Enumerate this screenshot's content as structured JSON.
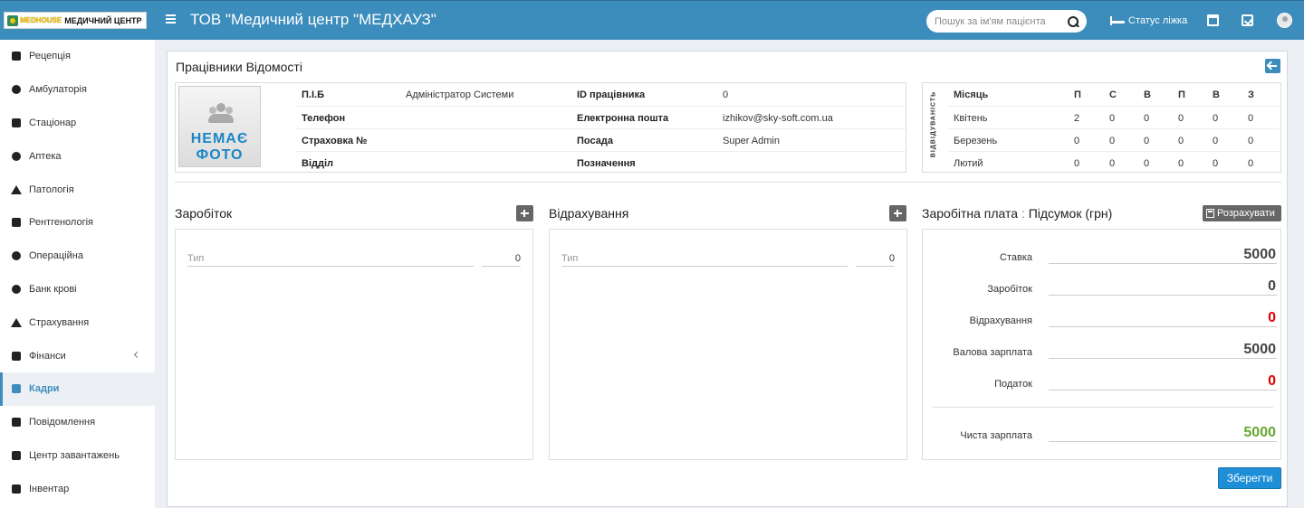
{
  "topbar": {
    "logo_brand": "MEDHOUSE",
    "logo_name": "МЕДИЧНИЙ ЦЕНТР",
    "title": "ТОВ \"Медичний центр \"МЕДХАУЗ\"",
    "search_placeholder": "Пошук за ім'ям пацієнта",
    "bed_status_label": "Статус ліжка",
    "icons": [
      "menu-icon",
      "search-icon",
      "bed-icon",
      "calendar-icon",
      "checklist-icon",
      "user-avatar"
    ]
  },
  "sidebar": {
    "items": [
      {
        "label": "Рецепція",
        "icon": "reception-icon"
      },
      {
        "label": "Амбулаторія",
        "icon": "stethoscope-icon"
      },
      {
        "label": "Стаціонар",
        "icon": "bed-icon"
      },
      {
        "label": "Аптека",
        "icon": "mortar-icon"
      },
      {
        "label": "Патологія",
        "icon": "flask-icon"
      },
      {
        "label": "Рентгенологія",
        "icon": "xray-icon"
      },
      {
        "label": "Операційна",
        "icon": "scissors-icon"
      },
      {
        "label": "Банк крові",
        "icon": "blood-drop-icon"
      },
      {
        "label": "Страхування",
        "icon": "umbrella-icon"
      },
      {
        "label": "Фінанси",
        "icon": "money-icon"
      },
      {
        "label": "Кадри",
        "icon": "sitemap-icon"
      },
      {
        "label": "Повідомлення",
        "icon": "bullhorn-icon"
      },
      {
        "label": "Центр завантажень",
        "icon": "download-icon"
      },
      {
        "label": "Інвентар",
        "icon": "inventory-icon"
      }
    ],
    "active_item": "Кадри",
    "expandable_item": "Фінанси"
  },
  "page": {
    "title": "Працівники Відомості",
    "photo_text_line1": "НЕМАЄ",
    "photo_text_line2": "ФОТО"
  },
  "employee": {
    "name_label": "П.І.Б",
    "name_value": "Адміністратор Системи",
    "id_label": "ID працівника",
    "id_value": "0",
    "phone_label": "Телефон",
    "phone_value": "",
    "email_label": "Електронна пошта",
    "email_value": "izhikov@sky-soft.com.ua",
    "insurance_label": "Страховка №",
    "insurance_value": "",
    "position_label": "Посада",
    "position_value": "Super Admin",
    "department_label": "Відділ",
    "department_value": "",
    "designation_label": "Позначення",
    "designation_value": ""
  },
  "attendance": {
    "vertical_label": "ВІДВІДУВАНІСТЬ",
    "month_header": "Місяць",
    "columns": [
      "П",
      "С",
      "В",
      "П",
      "В",
      "З"
    ],
    "rows": [
      {
        "month": "Квітень",
        "values": [
          "2",
          "0",
          "0",
          "0",
          "0",
          "0"
        ]
      },
      {
        "month": "Березень",
        "values": [
          "0",
          "0",
          "0",
          "0",
          "0",
          "0"
        ]
      },
      {
        "month": "Лютий",
        "values": [
          "0",
          "0",
          "0",
          "0",
          "0",
          "0"
        ]
      }
    ]
  },
  "earnings": {
    "title": "Заробіток",
    "type_placeholder": "Тип",
    "amount_value": "0"
  },
  "deductions": {
    "title": "Відрахування",
    "type_placeholder": "Тип",
    "amount_value": "0"
  },
  "summary": {
    "title": "Заробітна плата",
    "title_sep": ":",
    "title_suffix": "Підсумок (грн)",
    "calculate_label": "Розрахувати",
    "rows": [
      {
        "label": "Ставка",
        "value": "5000",
        "color": "#444444"
      },
      {
        "label": "Заробіток",
        "value": "0",
        "color": "#444444"
      },
      {
        "label": "Відрахування",
        "value": "0",
        "color": "#e00000"
      },
      {
        "label": "Валова зарплата",
        "value": "5000",
        "color": "#444444"
      },
      {
        "label": "Податок",
        "value": "0",
        "color": "#e00000"
      },
      {
        "label": "Чиста зарплата",
        "value": "5000",
        "color": "#67a834"
      }
    ]
  },
  "actions": {
    "save_label": "Зберегти"
  },
  "colors": {
    "brand": "#3c8dbc",
    "save_button": "#1e8fd6",
    "negative": "#e00000",
    "positive": "#67a834"
  }
}
